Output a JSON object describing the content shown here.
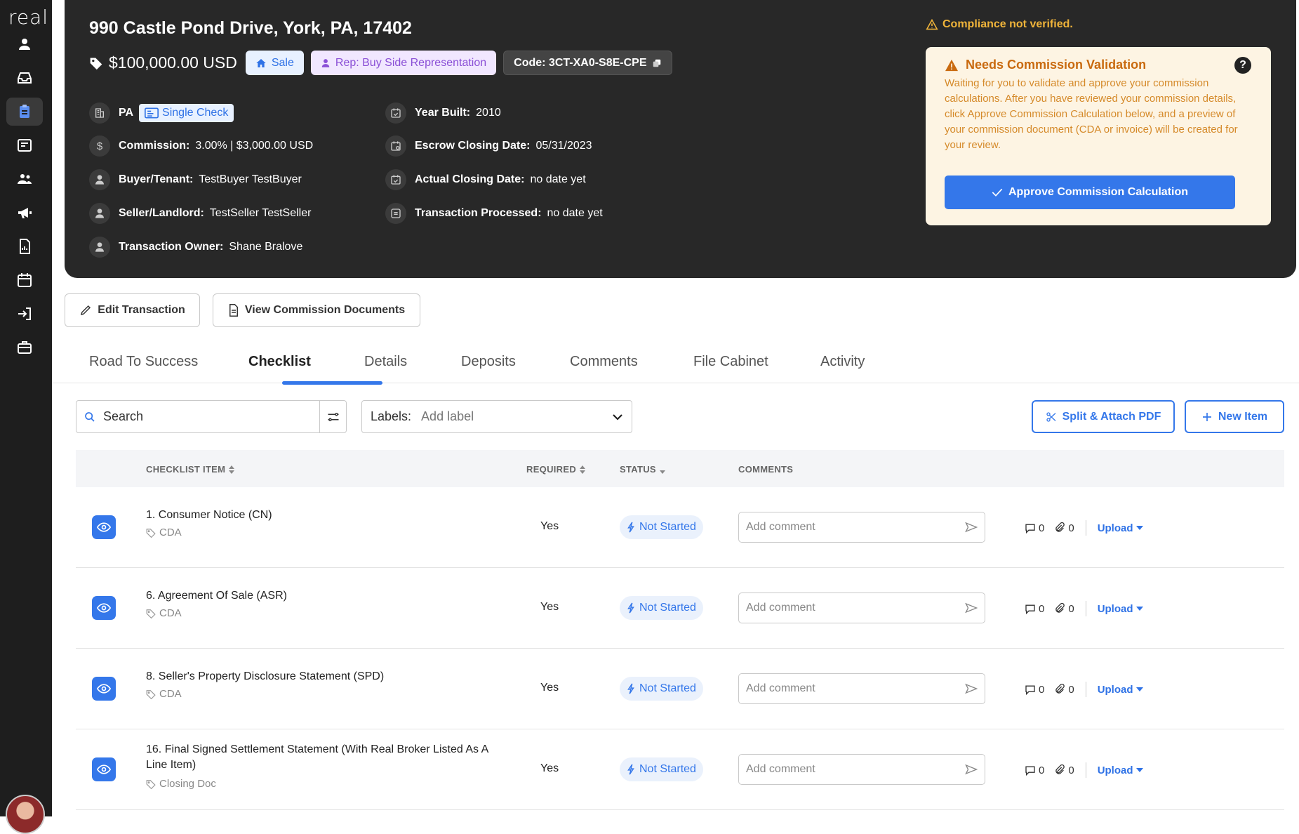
{
  "sidebar": {
    "logo": "real",
    "items": [
      "profile",
      "inbox",
      "transactions",
      "listings",
      "people",
      "marketing",
      "reports",
      "calendar",
      "import",
      "briefcase"
    ]
  },
  "transaction": {
    "address": "990 Castle Pond Drive, York, PA, 17402",
    "price": "$100,000.00 USD",
    "sale_label": "Sale",
    "rep_label": "Rep: Buy Side Representation",
    "code_label": "Code: 3CT-XA0-S8E-CPE",
    "state": "PA",
    "check_type": "Single Check",
    "commission_key": "Commission:",
    "commission_val": "3.00% | $3,000.00 USD",
    "buyer_key": "Buyer/Tenant:",
    "buyer_val": "TestBuyer TestBuyer",
    "seller_key": "Seller/Landlord:",
    "seller_val": "TestSeller TestSeller",
    "owner_key": "Transaction Owner:",
    "owner_val": "Shane Bralove",
    "year_key": "Year Built:",
    "year_val": "2010",
    "escrow_key": "Escrow Closing Date:",
    "escrow_val": "05/31/2023",
    "actual_key": "Actual Closing Date:",
    "actual_val": "no date yet",
    "processed_key": "Transaction Processed:",
    "processed_val": "no date yet"
  },
  "compliance": {
    "warning": "Compliance not verified.",
    "title": "Needs Commission Validation",
    "help": "?",
    "body": "Waiting for you to validate and approve your commission calculations. After you have reviewed your commission details, click Approve Commission Calculation below, and a preview of your commission document (CDA or invoice) will be created for your review.",
    "button": "Approve Commission Calculation"
  },
  "actions": {
    "edit": "Edit Transaction",
    "view_docs": "View Commission Documents"
  },
  "tabs": [
    "Road To Success",
    "Checklist",
    "Details",
    "Deposits",
    "Comments",
    "File Cabinet",
    "Activity"
  ],
  "toolbar": {
    "search_placeholder": "Search",
    "labels_key": "Labels:",
    "labels_placeholder": "Add label",
    "split_btn": "Split & Attach PDF",
    "new_btn": "New Item"
  },
  "table": {
    "headers": [
      "CHECKLIST ITEM",
      "REQUIRED",
      "STATUS",
      "COMMENTS"
    ],
    "rows": [
      {
        "title": "1. Consumer Notice (CN)",
        "label": "CDA",
        "required": "Yes",
        "status": "Not Started",
        "comment_placeholder": "Add comment",
        "comments": "0",
        "attachments": "0",
        "upload": "Upload"
      },
      {
        "title": "6. Agreement Of Sale (ASR)",
        "label": "CDA",
        "required": "Yes",
        "status": "Not Started",
        "comment_placeholder": "Add comment",
        "comments": "0",
        "attachments": "0",
        "upload": "Upload"
      },
      {
        "title": "8. Seller's Property Disclosure Statement (SPD)",
        "label": "CDA",
        "required": "Yes",
        "status": "Not Started",
        "comment_placeholder": "Add comment",
        "comments": "0",
        "attachments": "0",
        "upload": "Upload"
      },
      {
        "title": "16. Final Signed Settlement Statement (With Real Broker Listed As A Line Item)",
        "label": "Closing Doc",
        "required": "Yes",
        "status": "Not Started",
        "comment_placeholder": "Add comment",
        "comments": "0",
        "attachments": "0",
        "upload": "Upload"
      }
    ]
  },
  "colors": {
    "accent": "#3477ea",
    "header_bg": "#282828",
    "warning": "#f0b43a"
  }
}
